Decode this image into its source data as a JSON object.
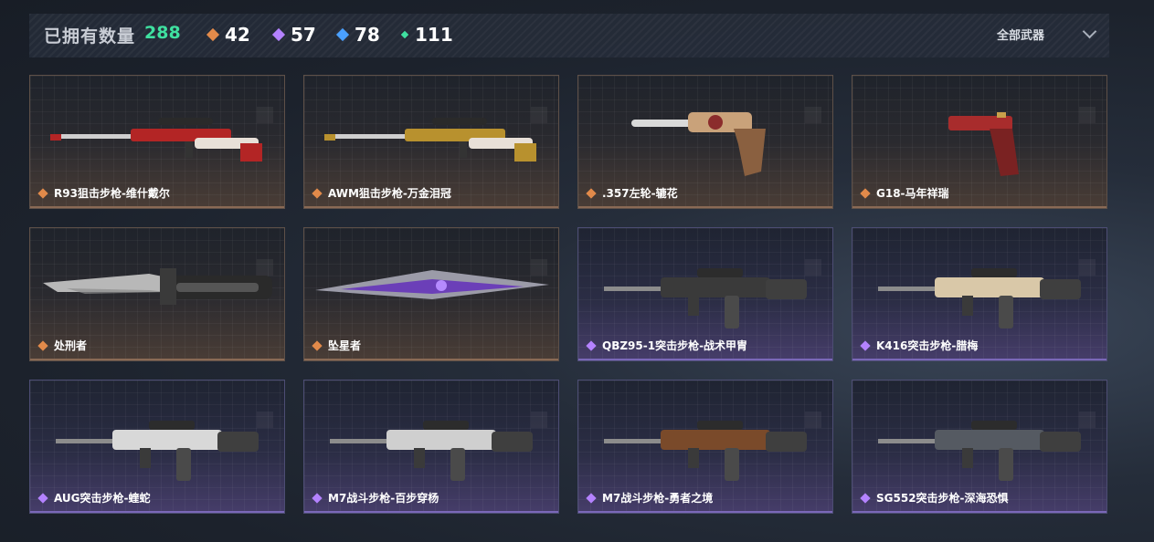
{
  "header": {
    "owned_label": "已拥有数量",
    "owned_count": "288",
    "stats": [
      {
        "icon": "orange-gem-icon",
        "value": "42",
        "color": "#e28a4a"
      },
      {
        "icon": "purple-gem-icon",
        "value": "57",
        "color": "#b482ff"
      },
      {
        "icon": "blue-gem-icon",
        "value": "78",
        "color": "#4aa0ff"
      },
      {
        "icon": "green-gem-icon",
        "value": "111",
        "color": "#3fe0a0"
      }
    ],
    "filter_label": "全部武器"
  },
  "weapons": [
    {
      "name": "R93狙击步枪-维什戴尔",
      "rarity": "orange",
      "type": "sniper",
      "accent": "#b32525"
    },
    {
      "name": "AWM狙击步枪-万金泪冠",
      "rarity": "orange",
      "type": "sniper",
      "accent": "#b8912e"
    },
    {
      "name": ".357左轮-辘花",
      "rarity": "orange",
      "type": "revolver",
      "accent": "#c9a27a"
    },
    {
      "name": "G18-马年祥瑞",
      "rarity": "orange",
      "type": "pistol",
      "accent": "#a82c2c"
    },
    {
      "name": "处刑者",
      "rarity": "orange",
      "type": "knife",
      "accent": "#8c8c8c"
    },
    {
      "name": "坠星者",
      "rarity": "orange",
      "type": "blade",
      "accent": "#6b3fb8"
    },
    {
      "name": "QBZ95-1突击步枪-战术甲胄",
      "rarity": "purple",
      "type": "rifle",
      "accent": "#3a3a3a"
    },
    {
      "name": "K416突击步枪-腊梅",
      "rarity": "purple",
      "type": "rifle",
      "accent": "#d9c8a8"
    },
    {
      "name": "AUG突击步枪-蝰蛇",
      "rarity": "purple",
      "type": "rifle",
      "accent": "#d8d8d8"
    },
    {
      "name": "M7战斗步枪-百步穿杨",
      "rarity": "purple",
      "type": "rifle",
      "accent": "#cfcfcf"
    },
    {
      "name": "M7战斗步枪-勇者之境",
      "rarity": "purple",
      "type": "rifle",
      "accent": "#7a4a2a"
    },
    {
      "name": "SG552突击步枪-深海恐惧",
      "rarity": "purple",
      "type": "rifle",
      "accent": "#555a62"
    }
  ],
  "colors": {
    "orange_rarity": "#e28a4a",
    "purple_rarity": "#b482ff",
    "count_green": "#3fe0a0"
  }
}
